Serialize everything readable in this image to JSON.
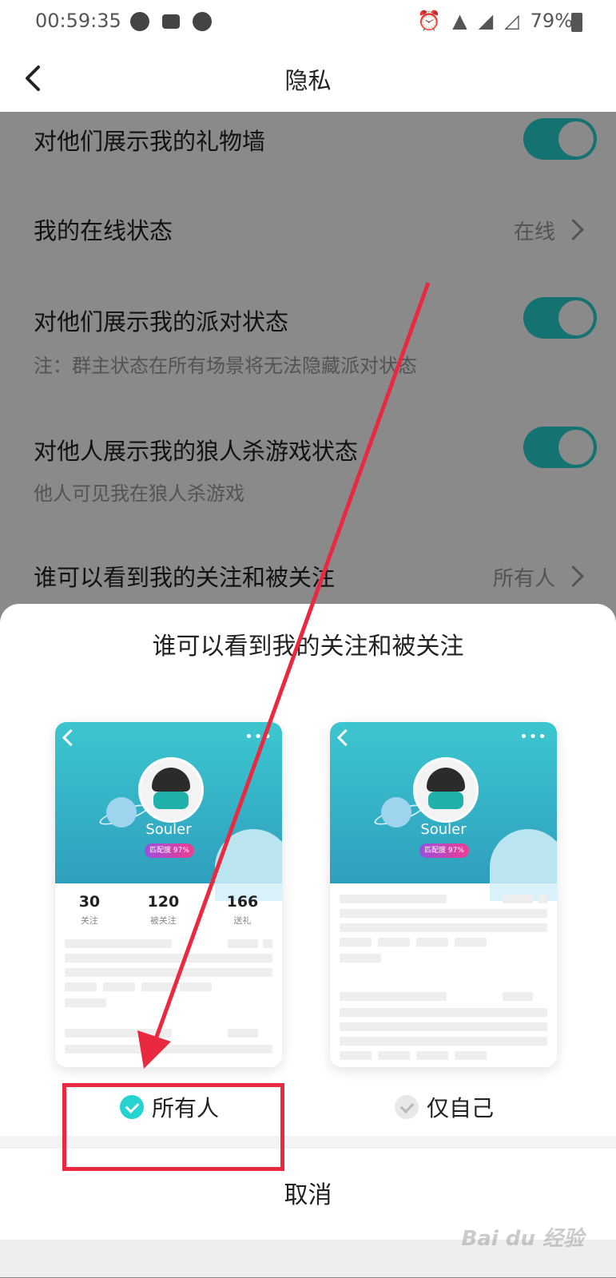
{
  "status_bar": {
    "time": "00:59:35",
    "battery": "79%",
    "left_icons": [
      "message-icon",
      "mail-icon",
      "app-icon"
    ],
    "right_icons": [
      "alarm-icon",
      "wifi-icon",
      "signal-icon",
      "signal-icon",
      "battery-icon"
    ]
  },
  "nav": {
    "title": "隐私"
  },
  "settings": [
    {
      "title": "对他们展示我的礼物墙",
      "type": "toggle",
      "on": true
    },
    {
      "title": "我的在线状态",
      "type": "link",
      "value": "在线"
    },
    {
      "title": "对他们展示我的派对状态",
      "subtitle": "注：群主状态在所有场景将无法隐藏派对状态",
      "type": "toggle",
      "on": true
    },
    {
      "title": "对他人展示我的狼人杀游戏状态",
      "subtitle": "他人可见我在狼人杀游戏",
      "type": "toggle",
      "on": true
    },
    {
      "title": "谁可以看到我的关注和被关注",
      "type": "link",
      "value": "所有人"
    }
  ],
  "sheet": {
    "title": "谁可以看到我的关注和被关注",
    "preview_cards": [
      {
        "name": "Souler",
        "badge": "匹配度 97%",
        "more": "•••",
        "stats": [
          {
            "value": "30",
            "label": "关注"
          },
          {
            "value": "120",
            "label": "被关注"
          },
          {
            "value": "166",
            "label": "送礼"
          }
        ]
      },
      {
        "name": "Souler",
        "badge": "匹配度 97%",
        "more": "•••"
      }
    ],
    "options": [
      {
        "label": "所有人",
        "selected": true
      },
      {
        "label": "仅自己",
        "selected": false
      }
    ],
    "cancel": "取消"
  },
  "colors": {
    "accent": "#25d4d0",
    "annotation": "#e8293f"
  },
  "watermark": "Bai du 经验"
}
